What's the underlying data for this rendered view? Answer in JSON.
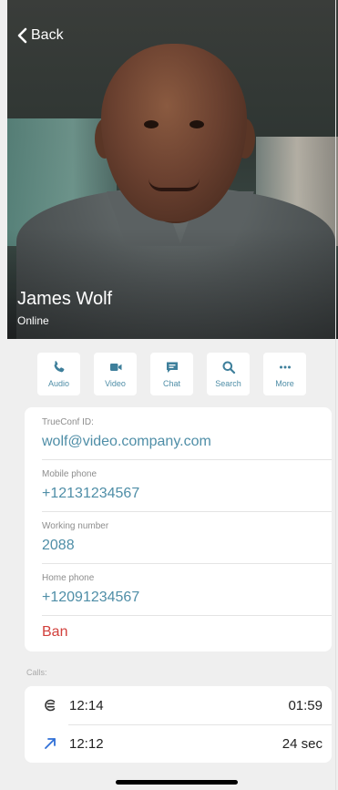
{
  "header": {
    "back_label": "Back"
  },
  "profile": {
    "name": "James Wolf",
    "status": "Online"
  },
  "actions": [
    {
      "label": "Audio",
      "icon": "phone-icon"
    },
    {
      "label": "Video",
      "icon": "video-camera-icon"
    },
    {
      "label": "Chat",
      "icon": "chat-bubble-icon"
    },
    {
      "label": "Search",
      "icon": "search-icon"
    },
    {
      "label": "More",
      "icon": "ellipsis-icon"
    }
  ],
  "info": {
    "trueconf_id_title": "TrueConf ID:",
    "trueconf_id_value": "wolf@video.company.com",
    "mobile_title": "Mobile phone",
    "mobile_value": "+12131234567",
    "working_title": "Working number",
    "working_value": "2088",
    "home_title": "Home phone",
    "home_value": "+12091234567",
    "ban_label": "Ban"
  },
  "calls": {
    "label": "Calls:",
    "items": [
      {
        "icon": "missed-call-icon",
        "time": "12:14",
        "duration": "01:59"
      },
      {
        "icon": "outgoing-call-arrow-icon",
        "time": "12:12",
        "duration": "24 sec"
      }
    ]
  },
  "colors": {
    "accent": "#4f8ea7",
    "danger": "#d2403c",
    "background": "#efefef"
  }
}
